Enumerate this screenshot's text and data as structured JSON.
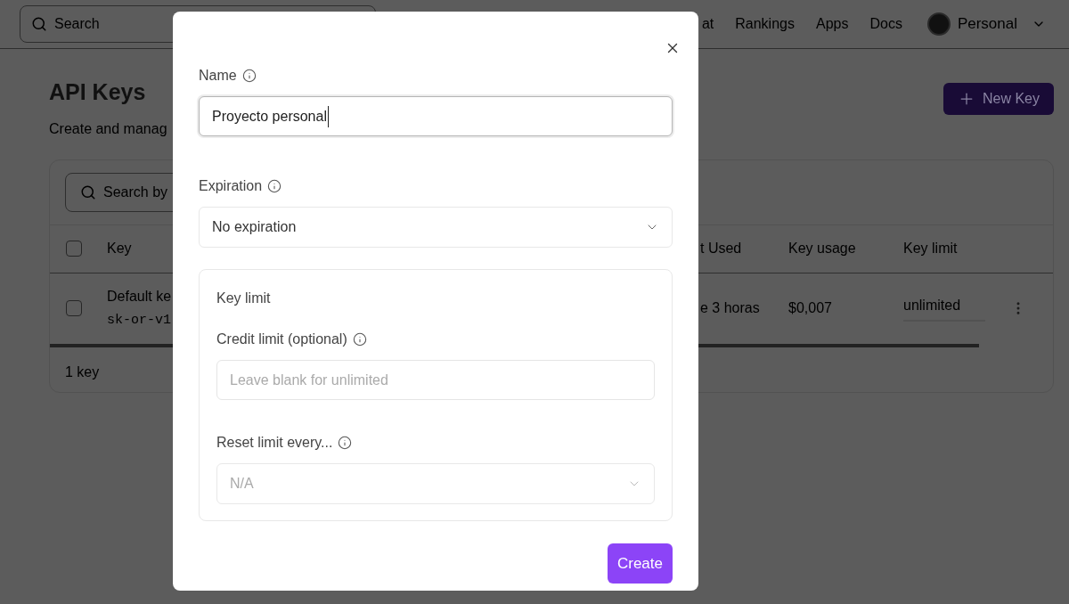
{
  "nav": {
    "search_placeholder": "Search",
    "links": [
      "at",
      "Rankings",
      "Apps",
      "Docs"
    ],
    "account": "Personal"
  },
  "page": {
    "title": "API Keys",
    "subtitle": "Create and manag",
    "new_key_button": "New Key"
  },
  "table": {
    "search_placeholder": "Search by",
    "header_checked": false,
    "columns": [
      "Key",
      "t Used",
      "Key usage",
      "Key limit"
    ],
    "rows": [
      {
        "name": "Default ke",
        "key": "sk-or-v1",
        "checked": false,
        "last_used": "e 3 horas",
        "usage": "$0,007",
        "limit": "unlimited"
      }
    ],
    "footer": "1 key"
  },
  "dialog": {
    "fields": [
      {
        "kind": "text",
        "label": "Name",
        "value": "Proyecto personal",
        "focused": true
      },
      {
        "kind": "select",
        "label": "Expiration",
        "value": "No expiration",
        "disabled": false
      }
    ],
    "key_limit": {
      "title": "Key limit",
      "fields": [
        {
          "kind": "text",
          "label": "Credit limit (optional)",
          "placeholder": "Leave blank for unlimited",
          "focused": false
        },
        {
          "kind": "select",
          "label": "Reset limit every...",
          "value": "N/A",
          "disabled": true
        }
      ]
    },
    "submit": "Create"
  }
}
